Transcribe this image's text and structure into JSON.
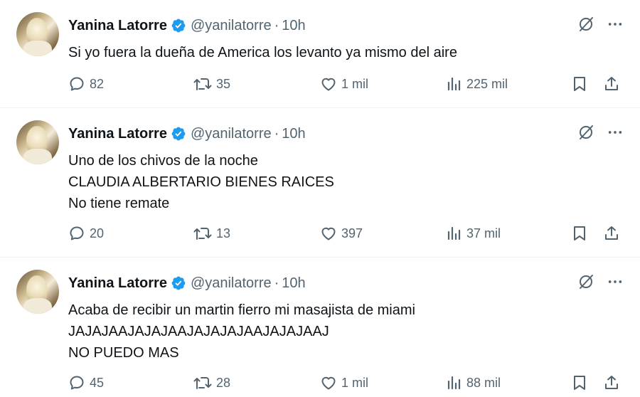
{
  "colors": {
    "verified": "#1d9bf0",
    "text": "#0f1419",
    "muted": "#536471",
    "divider": "#eff3f4"
  },
  "tweets": [
    {
      "name": "Yanina Latorre",
      "handle": "@yanilatorre",
      "dot": "·",
      "time": "10h",
      "lines": [
        "Si yo fuera la dueña de America los levanto ya mismo del aire"
      ],
      "replies": "82",
      "retweets": "35",
      "likes": "1 mil",
      "views": "225 mil"
    },
    {
      "name": "Yanina Latorre",
      "handle": "@yanilatorre",
      "dot": "·",
      "time": "10h",
      "lines": [
        "Uno de los chivos de la noche",
        "CLAUDIA ALBERTARIO BIENES RAICES",
        "No tiene remate"
      ],
      "replies": "20",
      "retweets": "13",
      "likes": "397",
      "views": "37 mil"
    },
    {
      "name": "Yanina Latorre",
      "handle": "@yanilatorre",
      "dot": "·",
      "time": "10h",
      "lines": [
        "Acaba de recibir un martin fierro mi masajista de miami",
        "JAJAJAAJAJAJAAJAJAJAJAAJAJAJAAJ",
        "NO PUEDO MAS"
      ],
      "replies": "45",
      "retweets": "28",
      "likes": "1 mil",
      "views": "88 mil"
    }
  ]
}
